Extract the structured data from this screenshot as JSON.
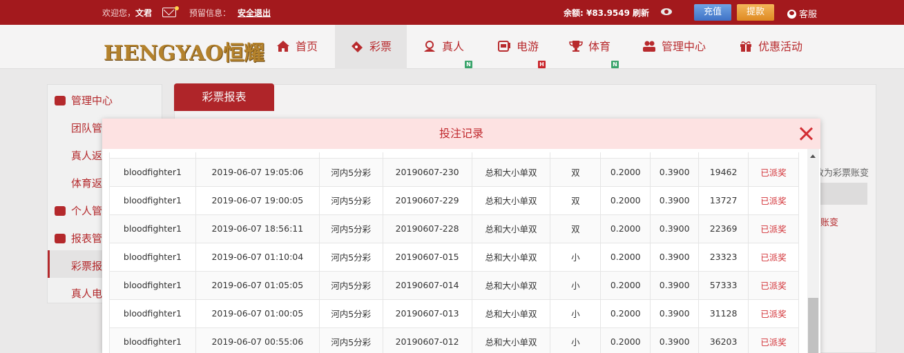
{
  "topbar": {
    "welcome_prefix": "欢迎您，",
    "username": "文君",
    "notice_label": "预留信息：",
    "logout": "安全退出",
    "balance": "余额: ¥83.9549",
    "refresh": "刷新",
    "recharge": "充值",
    "withdraw": "提款",
    "service": "客服"
  },
  "logo_text": "HENGYAO恒耀",
  "nav": {
    "items": [
      {
        "label": "首页",
        "icon": "home-icon"
      },
      {
        "label": "彩票",
        "icon": "lottery-ticket-icon"
      },
      {
        "label": "真人",
        "icon": "live-dealer-icon",
        "badge": "N"
      },
      {
        "label": "电游",
        "icon": "slot-machine-icon",
        "badge": "H"
      },
      {
        "label": "体育",
        "icon": "trophy-icon",
        "badge": "N"
      },
      {
        "label": "管理中心",
        "icon": "users-icon"
      },
      {
        "label": "优惠活动",
        "icon": "gift-icon"
      }
    ]
  },
  "sidebar": {
    "head1": "管理中心",
    "sub1": "团队管",
    "sub2": "真人返",
    "sub3": "体育返",
    "head2": "个人管",
    "head3": "报表管",
    "sub4": "彩票报",
    "sub5": "真人电"
  },
  "content": {
    "tab": "彩票报表",
    "bg_text_1": "改为彩票账变",
    "bg_text_2": "账变"
  },
  "modal": {
    "title": "投注记录",
    "rows": [
      {
        "user": "bloodfighter1",
        "time": "2019-06-07 19:05:06",
        "game": "河内5分彩",
        "issue": "20190607-230",
        "play": "总和大小单双",
        "bet": "双",
        "amount": "0.2000",
        "odds": "0.3900",
        "number": "19462",
        "status": "已派奖"
      },
      {
        "user": "bloodfighter1",
        "time": "2019-06-07 19:00:05",
        "game": "河内5分彩",
        "issue": "20190607-229",
        "play": "总和大小单双",
        "bet": "双",
        "amount": "0.2000",
        "odds": "0.3900",
        "number": "13727",
        "status": "已派奖"
      },
      {
        "user": "bloodfighter1",
        "time": "2019-06-07 18:56:11",
        "game": "河内5分彩",
        "issue": "20190607-228",
        "play": "总和大小单双",
        "bet": "双",
        "amount": "0.2000",
        "odds": "0.3900",
        "number": "22369",
        "status": "已派奖"
      },
      {
        "user": "bloodfighter1",
        "time": "2019-06-07 01:10:04",
        "game": "河内5分彩",
        "issue": "20190607-015",
        "play": "总和大小单双",
        "bet": "小",
        "amount": "0.2000",
        "odds": "0.3900",
        "number": "23323",
        "status": "已派奖"
      },
      {
        "user": "bloodfighter1",
        "time": "2019-06-07 01:05:05",
        "game": "河内5分彩",
        "issue": "20190607-014",
        "play": "总和大小单双",
        "bet": "小",
        "amount": "0.2000",
        "odds": "0.3900",
        "number": "57333",
        "status": "已派奖"
      },
      {
        "user": "bloodfighter1",
        "time": "2019-06-07 01:00:05",
        "game": "河内5分彩",
        "issue": "20190607-013",
        "play": "总和大小单双",
        "bet": "小",
        "amount": "0.2000",
        "odds": "0.3900",
        "number": "31128",
        "status": "已派奖"
      },
      {
        "user": "bloodfighter1",
        "time": "2019-06-07 00:55:06",
        "game": "河内5分彩",
        "issue": "20190607-012",
        "play": "总和大小单双",
        "bet": "小",
        "amount": "0.2000",
        "odds": "0.3900",
        "number": "36203",
        "status": "已派奖"
      }
    ]
  },
  "colors": {
    "brand_red": "#a3191d",
    "accent_red": "#b82a2d",
    "modal_header_bg": "#fde2e2",
    "recharge_blue": "#3f72c6",
    "withdraw_orange": "#de8a22",
    "badge_green": "#3aa46b"
  }
}
